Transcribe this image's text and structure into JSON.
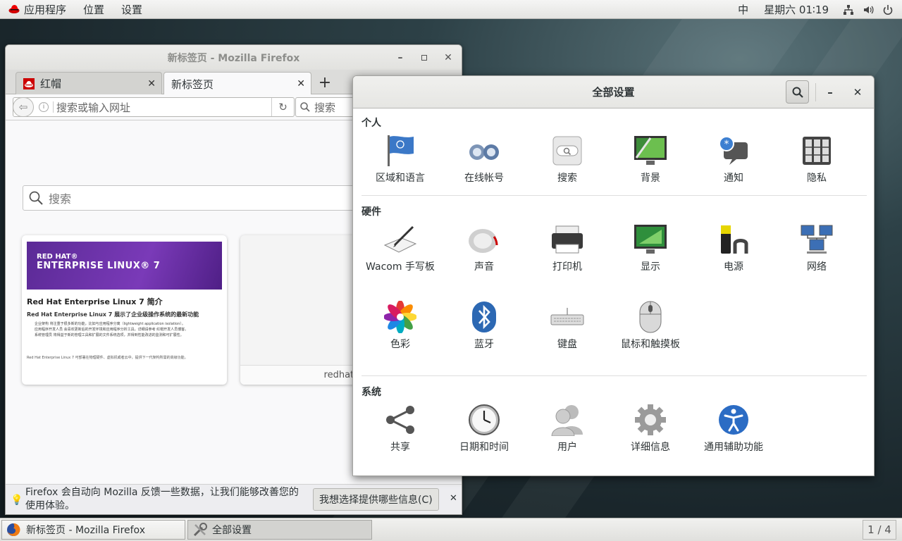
{
  "topbar": {
    "menu_apps": "应用程序",
    "menu_places": "位置",
    "menu_settings": "设置",
    "input_method": "中",
    "clock": "星期六 01∶19"
  },
  "firefox": {
    "window_title": "新标签页  -  Mozilla Firefox",
    "tabs": [
      {
        "label": "红帽"
      },
      {
        "label": "新标签页"
      }
    ],
    "url_placeholder": "搜索或输入网址",
    "search_placeholder": "搜索",
    "content_search_placeholder": "搜索",
    "tile1": {
      "banner_line1": "RED HAT®",
      "banner_line2": "ENTERPRISE LINUX® 7",
      "heading": "Red Hat Enterprise Linux 7 简介",
      "subheading": "Red Hat Enterprise Linux 7 展示了企业级操作系统的最新功能",
      "bullet1": "企业架构 将注重于很多新的功能，比如与应用程序分离（lightweight application isolation）。",
      "bullet2": "应用程序开发人员 会喜欢更新后的开发环境和应用程序分析工具。详细请参考 红帽开发人员博客。",
      "bullet3": "系统管理员 将得益于新的管理工具和扩展的文件系统选项，并得到性能改进的监测和可扩展性。",
      "footer": "Red Hat Enterprise Linux 7 可部署在物理硬件、虚拟机或者云中，提供下一代架构所需的高级功能。"
    },
    "tile2_label": "redhat.c",
    "notify_text": "Firefox 会自动向 Mozilla 反馈一些数据，让我们能够改善您的使用体验。",
    "notify_button": "我想选择提供哪些信息(C)"
  },
  "settings": {
    "title": "全部设置",
    "sections": {
      "personal": "个人",
      "hardware": "硬件",
      "system": "系统"
    },
    "personal": [
      "区域和语言",
      "在线帐号",
      "搜索",
      "背景",
      "通知",
      "隐私"
    ],
    "hardware": [
      "Wacom 手写板",
      "声音",
      "打印机",
      "显示",
      "电源",
      "网络",
      "色彩",
      "蓝牙",
      "键盘",
      "鼠标和触摸板"
    ],
    "system": [
      "共享",
      "日期和时间",
      "用户",
      "详细信息",
      "通用辅助功能"
    ]
  },
  "taskbar": {
    "task1": "新标签页 - Mozilla Firefox",
    "task2": "全部设置",
    "pager": "1 / 4"
  }
}
